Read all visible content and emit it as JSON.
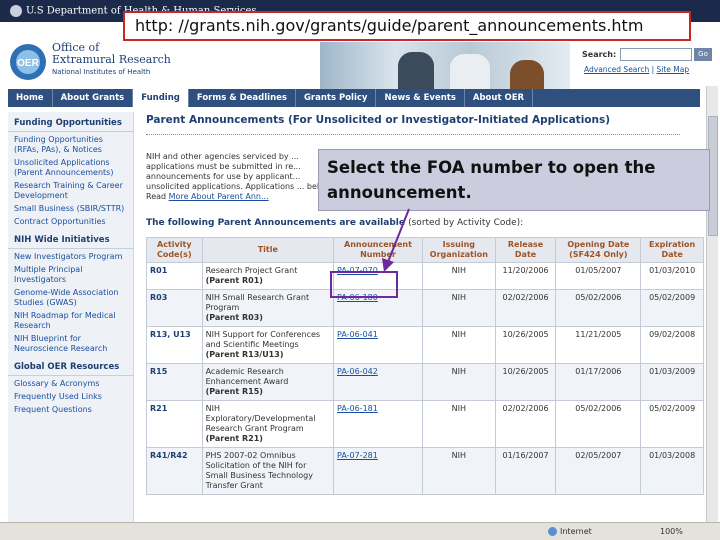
{
  "topbar": {
    "agency": "U.S Department of Health & Human Services"
  },
  "header": {
    "logo_text": "OER",
    "title_line1": "Office of",
    "title_line2": "Extramural Research",
    "subtitle": "National Institutes of Health"
  },
  "search": {
    "label": "Search:",
    "placeholder": "",
    "go_label": "Go",
    "advanced": "Advanced Search",
    "sep": "|",
    "sitemap": "Site Map"
  },
  "nav": {
    "tabs": [
      {
        "label": "Home"
      },
      {
        "label": "About Grants"
      },
      {
        "label": "Funding",
        "active": true
      },
      {
        "label": "Forms & Deadlines"
      },
      {
        "label": "Grants Policy"
      },
      {
        "label": "News & Events"
      },
      {
        "label": "About OER"
      }
    ]
  },
  "sidebar": {
    "sections": [
      {
        "title": "Funding Opportunities",
        "items": [
          "Funding Opportunities (RFAs, PAs), & Notices",
          "Unsolicited Applications (Parent Announcements)",
          "Research Training & Career Development",
          "Small Business (SBIR/STTR)",
          "Contract Opportunities"
        ]
      },
      {
        "title": "NIH Wide Initiatives",
        "items": [
          "New Investigators Program",
          "Multiple Principal Investigators",
          "Genome-Wide Association Studies (GWAS)",
          "NIH Roadmap for Medical Research",
          "NIH Blueprint for Neuroscience Research"
        ]
      },
      {
        "title": "Global OER Resources",
        "items": [
          "Glossary & Acronyms",
          "Frequently Used Links",
          "Frequent Questions"
        ]
      }
    ]
  },
  "main": {
    "page_title": "Parent Announcements (For Unsolicited or Investigator-Initiated Applications)",
    "intro_text": "NIH and other agencies serviced by ... applications must be submitted in re... announcements for use by applicant... unsolicited applications. Applications ... below. Read",
    "intro_link": "More About Parent Ann...",
    "available_text": "The following Parent Announcements are available",
    "sorted_text": "(sorted by Activity Code):"
  },
  "table": {
    "headers": [
      "Activity Code(s)",
      "Title",
      "Announcement Number",
      "Issuing Organization",
      "Release Date",
      "Opening Date (SF424 Only)",
      "Expiration Date"
    ],
    "rows": [
      {
        "code": "R01",
        "title": "Research Project Grant",
        "parent": "(Parent R01)",
        "number": "PA-07-070",
        "org": "NIH",
        "release": "11/20/2006",
        "opening": "01/05/2007",
        "expiration": "01/03/2010"
      },
      {
        "code": "R03",
        "title": "NIH Small Research Grant Program",
        "parent": "(Parent R03)",
        "number": "PA-06-180",
        "org": "NIH",
        "release": "02/02/2006",
        "opening": "05/02/2006",
        "expiration": "05/02/2009"
      },
      {
        "code": "R13, U13",
        "title": "NIH Support for Conferences and Scientific Meetings",
        "parent": "(Parent R13/U13)",
        "number": "PA-06-041",
        "org": "NIH",
        "release": "10/26/2005",
        "opening": "11/21/2005",
        "expiration": "09/02/2008"
      },
      {
        "code": "R15",
        "title": "Academic Research Enhancement Award",
        "parent": "(Parent R15)",
        "number": "PA-06-042",
        "org": "NIH",
        "release": "10/26/2005",
        "opening": "01/17/2006",
        "expiration": "01/03/2009"
      },
      {
        "code": "R21",
        "title": "NIH Exploratory/Developmental Research Grant Program",
        "parent": "(Parent R21)",
        "number": "PA-06-181",
        "org": "NIH",
        "release": "02/02/2006",
        "opening": "05/02/2006",
        "expiration": "05/02/2009"
      },
      {
        "code": "R41/R42",
        "title": "PHS 2007-02 Omnibus Solicitation of the NIH for Small Business Technology Transfer Grant",
        "parent": "",
        "number": "PA-07-281",
        "org": "NIH",
        "release": "01/16/2007",
        "opening": "02/05/2007",
        "expiration": "01/03/2008"
      }
    ]
  },
  "status": {
    "zone": "Internet",
    "zoom": "100%"
  },
  "callouts": {
    "url": "http: //grants.nih.gov/grants/guide/parent_announcements.htm",
    "instruction": "Select the FOA number to open the announcement."
  },
  "colors": {
    "nav_bg": "#2f4f7f",
    "header_text": "#a05423",
    "link": "#1a4fa0",
    "callout_border": "#c62828",
    "highlight": "#6d2a9c"
  }
}
